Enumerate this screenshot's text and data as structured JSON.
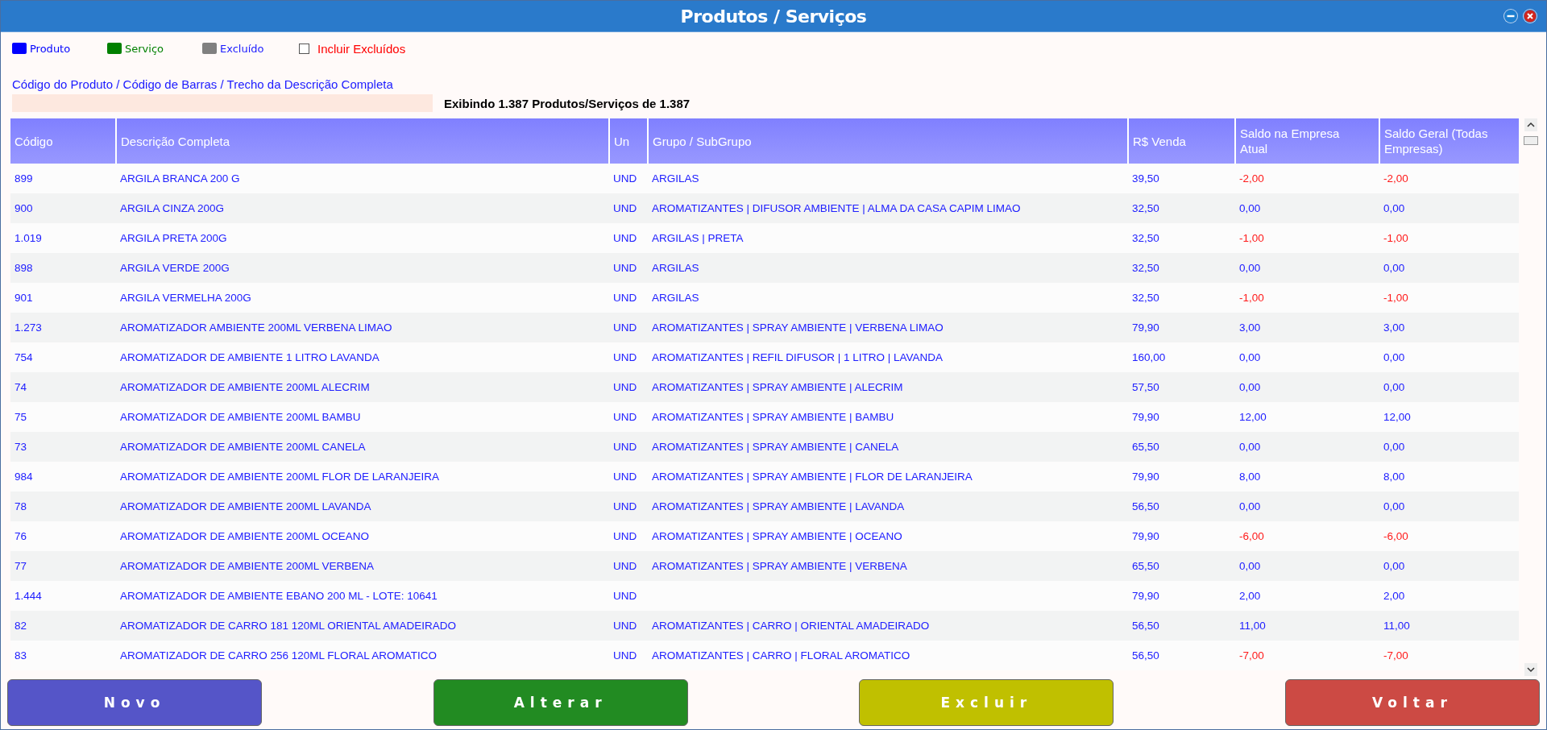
{
  "window": {
    "title": "Produtos / Serviços"
  },
  "legend": [
    {
      "label": "Produto",
      "color": "#0000ff"
    },
    {
      "label": "Serviço",
      "color": "#008000"
    },
    {
      "label": "Excluído",
      "color": "#808080"
    }
  ],
  "include_deleted": {
    "label": "Incluir Excluídos",
    "checked": false
  },
  "search": {
    "label": "Código do Produto / Código de Barras / Trecho da Descrição Completa"
  },
  "summary": "Exibindo 1.387 Produtos/Serviços de 1.387",
  "table": {
    "columns": [
      "Código",
      "Descrição Completa",
      "Un",
      "Grupo / SubGrupo",
      "R$ Venda",
      "Saldo na Empresa Atual",
      "Saldo Geral (Todas Empresas)"
    ],
    "rows": [
      {
        "cells": [
          "899",
          "ARGILA BRANCA 200 G",
          "UND",
          "ARGILAS",
          "39,50",
          "-2,00",
          "-2,00"
        ],
        "negative": true
      },
      {
        "cells": [
          "900",
          "ARGILA CINZA 200G",
          "UND",
          "AROMATIZANTES | DIFUSOR AMBIENTE | ALMA DA CASA CAPIM LIMAO",
          "32,50",
          "0,00",
          "0,00"
        ],
        "negative": false
      },
      {
        "cells": [
          "1.019",
          "ARGILA PRETA 200G",
          "UND",
          "ARGILAS | PRETA",
          "32,50",
          "-1,00",
          "-1,00"
        ],
        "negative": true
      },
      {
        "cells": [
          "898",
          "ARGILA VERDE 200G",
          "UND",
          "ARGILAS",
          "32,50",
          "0,00",
          "0,00"
        ],
        "negative": false
      },
      {
        "cells": [
          "901",
          "ARGILA VERMELHA 200G",
          "UND",
          "ARGILAS",
          "32,50",
          "-1,00",
          "-1,00"
        ],
        "negative": true
      },
      {
        "cells": [
          "1.273",
          "AROMATIZADOR AMBIENTE 200ML VERBENA LIMAO",
          "UND",
          "AROMATIZANTES | SPRAY AMBIENTE | VERBENA LIMAO",
          "79,90",
          "3,00",
          "3,00"
        ],
        "negative": false
      },
      {
        "cells": [
          "754",
          "AROMATIZADOR DE AMBIENTE 1 LITRO LAVANDA",
          "UND",
          "AROMATIZANTES | REFIL DIFUSOR | 1 LITRO | LAVANDA",
          "160,00",
          "0,00",
          "0,00"
        ],
        "negative": false
      },
      {
        "cells": [
          "74",
          "AROMATIZADOR DE AMBIENTE 200ML ALECRIM",
          "UND",
          "AROMATIZANTES | SPRAY AMBIENTE | ALECRIM",
          "57,50",
          "0,00",
          "0,00"
        ],
        "negative": false
      },
      {
        "cells": [
          "75",
          "AROMATIZADOR DE AMBIENTE 200ML BAMBU",
          "UND",
          "AROMATIZANTES | SPRAY AMBIENTE | BAMBU",
          "79,90",
          "12,00",
          "12,00"
        ],
        "negative": false
      },
      {
        "cells": [
          "73",
          "AROMATIZADOR DE AMBIENTE 200ML CANELA",
          "UND",
          "AROMATIZANTES | SPRAY AMBIENTE | CANELA",
          "65,50",
          "0,00",
          "0,00"
        ],
        "negative": false
      },
      {
        "cells": [
          "984",
          "AROMATIZADOR DE AMBIENTE 200ML FLOR DE LARANJEIRA",
          "UND",
          "AROMATIZANTES | SPRAY AMBIENTE | FLOR DE LARANJEIRA",
          "79,90",
          "8,00",
          "8,00"
        ],
        "negative": false
      },
      {
        "cells": [
          "78",
          "AROMATIZADOR DE AMBIENTE 200ML LAVANDA",
          "UND",
          "AROMATIZANTES | SPRAY AMBIENTE | LAVANDA",
          "56,50",
          "0,00",
          "0,00"
        ],
        "negative": false
      },
      {
        "cells": [
          "76",
          "AROMATIZADOR DE AMBIENTE 200ML OCEANO",
          "UND",
          "AROMATIZANTES | SPRAY AMBIENTE | OCEANO",
          "79,90",
          "-6,00",
          "-6,00"
        ],
        "negative": true
      },
      {
        "cells": [
          "77",
          "AROMATIZADOR DE AMBIENTE 200ML VERBENA",
          "UND",
          "AROMATIZANTES | SPRAY AMBIENTE | VERBENA",
          "65,50",
          "0,00",
          "0,00"
        ],
        "negative": false
      },
      {
        "cells": [
          "1.444",
          "AROMATIZADOR DE AMBIENTE EBANO 200 ML - LOTE: 10641",
          "UND",
          "",
          "79,90",
          "2,00",
          "2,00"
        ],
        "negative": false
      },
      {
        "cells": [
          "82",
          "AROMATIZADOR DE CARRO 181 120ML ORIENTAL AMADEIRADO",
          "UND",
          "AROMATIZANTES | CARRO | ORIENTAL AMADEIRADO",
          "56,50",
          "11,00",
          "11,00"
        ],
        "negative": false
      },
      {
        "cells": [
          "83",
          "AROMATIZADOR DE CARRO 256 120ML FLORAL AROMATICO",
          "UND",
          "AROMATIZANTES | CARRO | FLORAL AROMATICO",
          "56,50",
          "-7,00",
          "-7,00"
        ],
        "negative": true
      }
    ]
  },
  "buttons": [
    {
      "label": "Novo",
      "kind": "new"
    },
    {
      "label": "Alterar",
      "kind": "edit"
    },
    {
      "label": "Excluir",
      "kind": "delete"
    },
    {
      "label": "Voltar",
      "kind": "back"
    }
  ]
}
